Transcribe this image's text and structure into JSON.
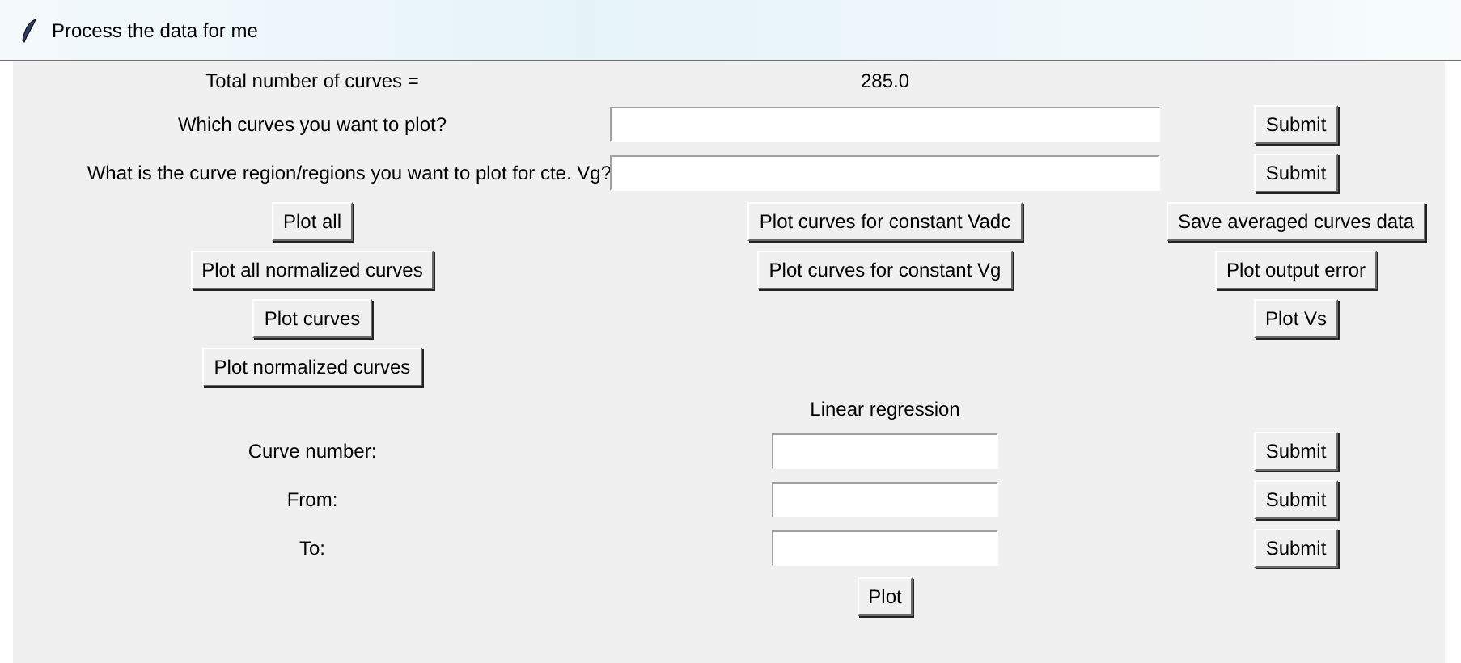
{
  "window": {
    "title": "Process the data for me"
  },
  "total_curves": {
    "label": "Total number of curves =",
    "value": "285.0"
  },
  "queries": [
    {
      "label": "Which curves you want to plot?",
      "button": "Submit"
    },
    {
      "label": "What is the curve region/regions you want to plot for cte. Vg?",
      "button": "Submit"
    }
  ],
  "plot_buttons": {
    "column_1": [
      "Plot all",
      "Plot all normalized curves",
      "Plot curves",
      "Plot normalized curves"
    ],
    "column_2": [
      "Plot curves for constant Vadc",
      "Plot curves for constant Vg"
    ],
    "column_3": [
      "Save averaged curves data",
      "Plot output error",
      "Plot Vs"
    ]
  },
  "linear_regression": {
    "title": "Linear regression",
    "fields": [
      {
        "label": "Curve number:",
        "button": "Submit"
      },
      {
        "label": "From:",
        "button": "Submit"
      },
      {
        "label": "To:",
        "button": "Submit"
      }
    ],
    "plot_button": "Plot"
  }
}
